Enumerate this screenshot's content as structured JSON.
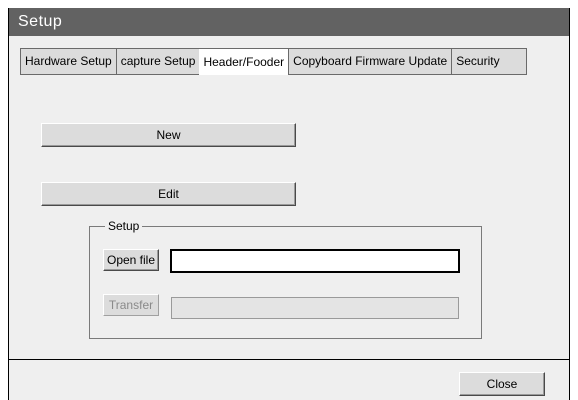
{
  "window": {
    "title": "Setup"
  },
  "tabs": [
    {
      "label": "Hardware Setup",
      "active": false
    },
    {
      "label": "capture Setup",
      "active": false
    },
    {
      "label": "Header/Fooder",
      "active": true
    },
    {
      "label": "Copyboard Firmware Update",
      "active": false
    },
    {
      "label": "Security",
      "active": false
    }
  ],
  "main": {
    "new_label": "New",
    "edit_label": "Edit",
    "setup_group": {
      "legend": "Setup",
      "open_file_label": "Open file",
      "file_value": "",
      "transfer_label": "Transfer",
      "transfer_value": ""
    }
  },
  "footer": {
    "close_label": "Close"
  },
  "colors": {
    "titlebar": "#626262",
    "panel": "#efefef",
    "button": "#dcdcdc"
  }
}
